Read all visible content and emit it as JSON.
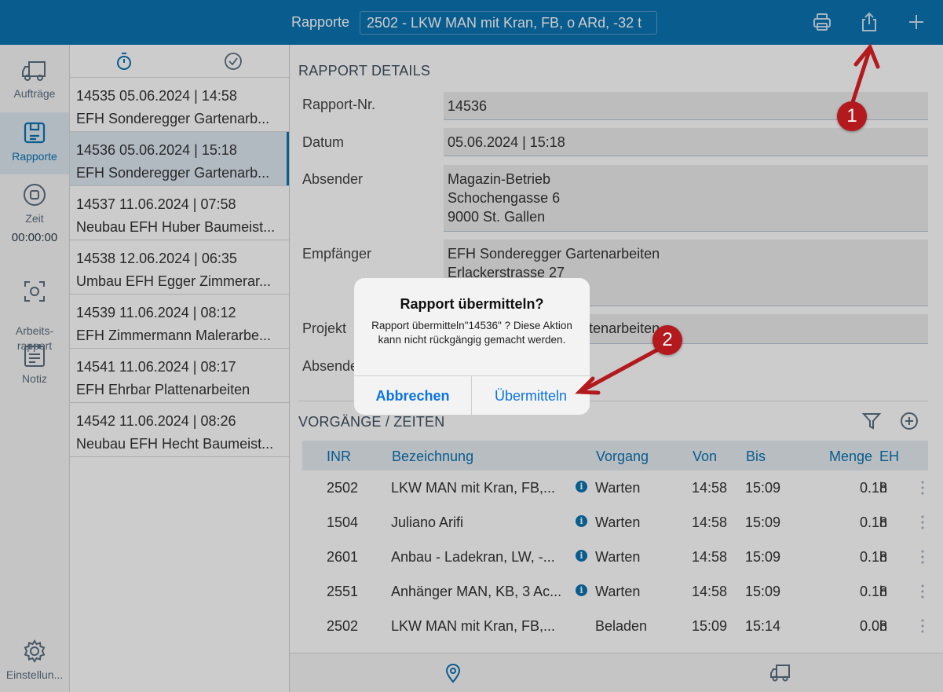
{
  "topbar": {
    "title": "Rapporte",
    "selected_vehicle": "2502 - LKW MAN mit Kran, FB, o ARd, -32 t",
    "icons": [
      "printer-icon",
      "share-icon",
      "plus-icon"
    ]
  },
  "rail": {
    "items": [
      {
        "label": "Aufträge",
        "icon": "truck-icon"
      },
      {
        "label": "Rapporte",
        "icon": "report-icon"
      },
      {
        "label": "Zeit",
        "icon": "stop-circle-icon",
        "extra": "00:00:00"
      },
      {
        "label": "Arbeits-\nrapport",
        "icon": "target-icon"
      },
      {
        "label": "Notiz",
        "icon": "notepad-icon"
      },
      {
        "label": "Einstellun...",
        "icon": "gear-icon"
      }
    ]
  },
  "list": {
    "items": [
      {
        "line1": "14535  05.06.2024 | 14:58",
        "line2": "EFH Sonderegger Gartenarb..."
      },
      {
        "line1": "14536  05.06.2024 | 15:18",
        "line2": "EFH Sonderegger Gartenarb..."
      },
      {
        "line1": "14537  11.06.2024 | 07:58",
        "line2": "Neubau EFH Huber Baumeist..."
      },
      {
        "line1": "14538  12.06.2024 | 06:35",
        "line2": "Umbau EFH Egger Zimmerar..."
      },
      {
        "line1": "14539  11.06.2024 | 08:12",
        "line2": "EFH Zimmermann Malerarbe..."
      },
      {
        "line1": "14541  11.06.2024 | 08:17",
        "line2": "EFH Ehrbar Plattenarbeiten"
      },
      {
        "line1": "14542  11.06.2024 | 08:26",
        "line2": "Neubau EFH Hecht Baumeist..."
      }
    ]
  },
  "details": {
    "section_title": "RAPPORT DETAILS",
    "fields": [
      {
        "label": "Rapport-Nr.",
        "value": "14536"
      },
      {
        "label": "Datum",
        "value": "05.06.2024 | 15:18"
      },
      {
        "label": "Absender",
        "value": "Magazin-Betrieb\nSchochengasse 6\n9000 St. Gallen"
      },
      {
        "label": "Empfänger",
        "value": "EFH Sonderegger Gartenarbeiten\nErlackerstrasse 27"
      },
      {
        "label": "Projekt",
        "value": "EFH Sonderegger Gartenarbeiten"
      },
      {
        "label": "Absender",
        "value": ""
      }
    ]
  },
  "vorgaenge": {
    "section_title": "VORGÄNGE / ZEITEN",
    "headers": [
      "INR",
      "Bezeichnung",
      "Vorgang",
      "Von",
      "Bis",
      "Menge",
      "EH"
    ],
    "rows": [
      {
        "inr": "2502",
        "bez": "LKW MAN mit Kran, FB,...",
        "info": true,
        "vorgang": "Warten",
        "von": "14:58",
        "bis": "15:09",
        "menge": "0.18",
        "eh": "h"
      },
      {
        "inr": "1504",
        "bez": "Juliano Arifi",
        "info": true,
        "vorgang": "Warten",
        "von": "14:58",
        "bis": "15:09",
        "menge": "0.18",
        "eh": "h"
      },
      {
        "inr": "2601",
        "bez": "Anbau - Ladekran, LW, -...",
        "info": true,
        "vorgang": "Warten",
        "von": "14:58",
        "bis": "15:09",
        "menge": "0.18",
        "eh": "h"
      },
      {
        "inr": "2551",
        "bez": "Anhänger MAN, KB, 3 Ac...",
        "info": true,
        "vorgang": "Warten",
        "von": "14:58",
        "bis": "15:09",
        "menge": "0.18",
        "eh": "h"
      },
      {
        "inr": "2502",
        "bez": "LKW MAN mit Kran, FB,...",
        "info": false,
        "vorgang": "Beladen",
        "von": "15:09",
        "bis": "15:14",
        "menge": "0.08",
        "eh": "h"
      }
    ]
  },
  "dialog": {
    "title": "Rapport übermitteln?",
    "message": "Rapport übermitteln\"14536\" ? Diese Aktion kann nicht rückgängig gemacht werden.",
    "cancel_label": "Abbrechen",
    "confirm_label": "Übermitteln"
  },
  "annotations": {
    "badge1": "1",
    "badge2": "2",
    "color": "#b3191d"
  },
  "colors": {
    "brand": "#0a73b2",
    "selected_bg": "#dfe9f2",
    "flag": "#e06a6a"
  }
}
